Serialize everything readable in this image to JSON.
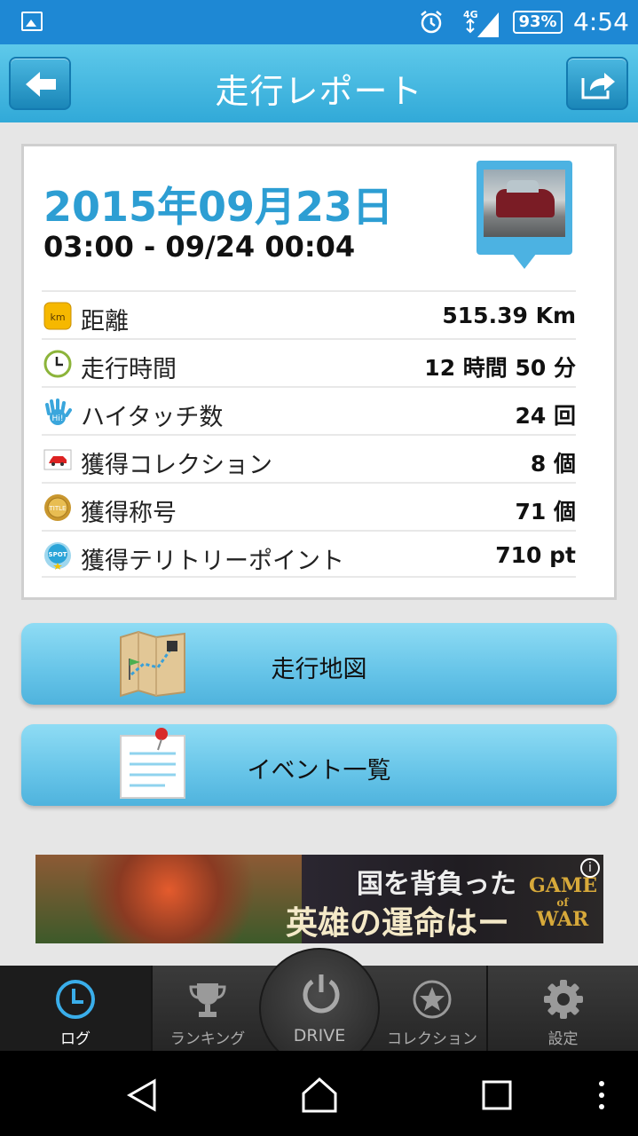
{
  "status_bar": {
    "battery": "93%",
    "time": "4:54",
    "network": "4G"
  },
  "header": {
    "title": "走行レポート"
  },
  "report": {
    "date": "2015年09月23日",
    "time_range": "03:00 - 09/24 00:04",
    "stats": [
      {
        "icon": "km-icon",
        "label": "距離",
        "value": "515.39 Km"
      },
      {
        "icon": "clock-icon",
        "label": "走行時間",
        "value": "12 時間 50 分"
      },
      {
        "icon": "hi-five-icon",
        "label": "ハイタッチ数",
        "value": "24 回"
      },
      {
        "icon": "car-card-icon",
        "label": "獲得コレクション",
        "value": "8 個"
      },
      {
        "icon": "medal-icon",
        "label": "獲得称号",
        "value": "71 個"
      },
      {
        "icon": "spot-icon",
        "label": "獲得テリトリーポイント",
        "value": "710 pt"
      }
    ]
  },
  "buttons": {
    "map": "走行地図",
    "events": "イベント一覧"
  },
  "ad": {
    "line1": "国を背負った",
    "line2": "英雄の運命はー",
    "logo_line1": "GAME",
    "logo_line2": "of",
    "logo_line3": "WAR",
    "info": "i"
  },
  "tabs": {
    "log": "ログ",
    "ranking": "ランキング",
    "drive": "DRIVE",
    "collection": "コレクション",
    "settings": "設定"
  },
  "colors": {
    "accent": "#2d9ed3",
    "header": "#31a9d8",
    "status": "#1e88d4"
  }
}
